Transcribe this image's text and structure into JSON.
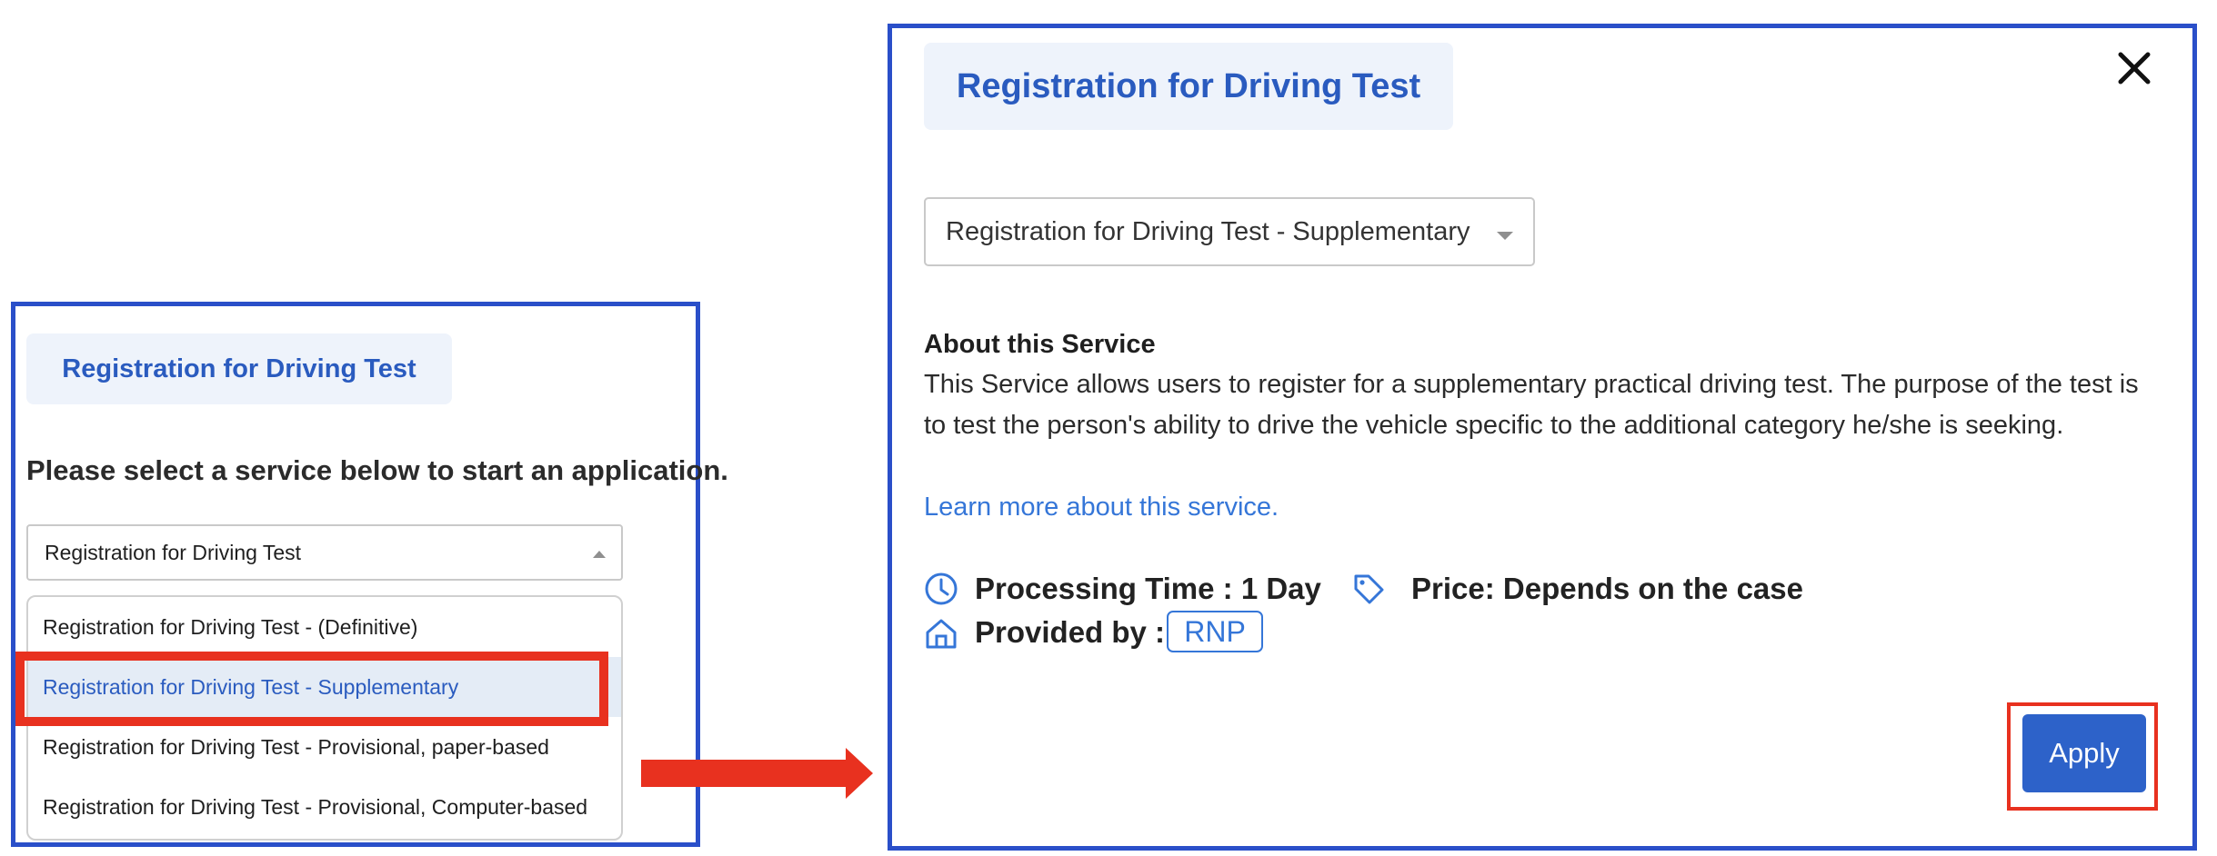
{
  "left_panel": {
    "badge_title": "Registration for Driving Test",
    "prompt": "Please select a service below to start an application.",
    "select_value": "Registration for Driving Test",
    "options": [
      "Registration for Driving Test - (Definitive)",
      "Registration for Driving Test - Supplementary",
      "Registration for Driving Test - Provisional, paper-based",
      "Registration for Driving Test - Provisional, Computer-based"
    ],
    "selected_option": "Registration for Driving Test - Supplementary"
  },
  "right_panel": {
    "badge_title": "Registration for Driving Test",
    "select_value": "Registration for Driving Test - Supplementary",
    "about_heading": "About this Service",
    "about_text": "This Service allows users to register for a supplementary practical driving test. The purpose of the test is to test the person's ability to drive the vehicle specific to the additional category he/she is seeking.",
    "learn_more": "Learn more about this service.",
    "processing_time": "Processing Time : 1 Day",
    "price": "Price: Depends on the case",
    "provided_by_label": "Provided by :",
    "provider": "RNP",
    "apply_label": "Apply"
  },
  "icons": {
    "close": "close-icon",
    "clock": "clock-icon",
    "tag": "price-tag-icon",
    "home": "home-icon"
  },
  "colors": {
    "panel_border": "#2a4fc9",
    "accent_blue": "#2a5bbf",
    "link_blue": "#3576d8",
    "highlight_red": "#e8311f",
    "badge_bg": "#eef3fb",
    "button_blue": "#2d62c9"
  }
}
